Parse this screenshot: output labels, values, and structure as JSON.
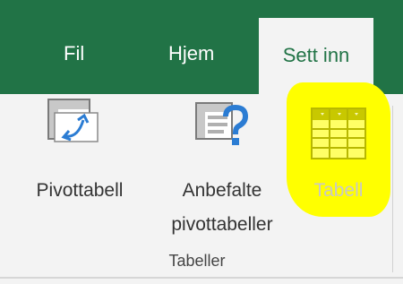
{
  "ribbon_tabs": {
    "fil": "Fil",
    "hjem": "Hjem",
    "sett_inn": "Sett inn"
  },
  "selected_tab": "Sett inn",
  "groups": {
    "tabeller": {
      "label": "Tabeller",
      "commands": {
        "pivot": {
          "label": "Pivottabell",
          "icon": "pivot-table-icon"
        },
        "recommended": {
          "label_line1": "Anbefalte",
          "label_line2": "pivottabeller",
          "icon": "recommended-pivot-tables-icon"
        },
        "table": {
          "label": "Tabell",
          "icon": "table-icon",
          "highlight": "#ffff00"
        }
      }
    }
  },
  "colors": {
    "tab_bar": "#217346",
    "ribbon": "#f3f3f3",
    "highlight": "#ffff00"
  }
}
